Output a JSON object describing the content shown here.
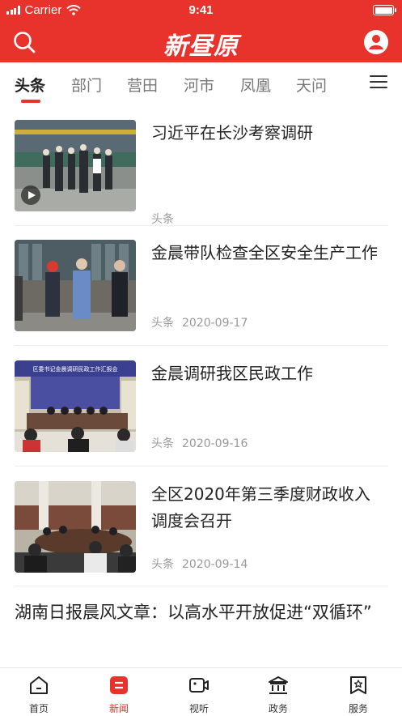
{
  "status_bar": {
    "carrier": "Carrier",
    "time": "9:41"
  },
  "header": {
    "logo_text": "新昼原"
  },
  "tabs": [
    {
      "label": "头条"
    },
    {
      "label": "部门"
    },
    {
      "label": "营田"
    },
    {
      "label": "河市"
    },
    {
      "label": "凤凰"
    },
    {
      "label": "天问"
    }
  ],
  "articles": [
    {
      "title": "习近平在长沙考察调研",
      "category": "头条",
      "date": ""
    },
    {
      "title": "金晨带队检查全区安全生产工作",
      "category": "头条",
      "date": "2020-09-17"
    },
    {
      "title": "金晨调研我区民政工作",
      "category": "头条",
      "date": "2020-09-16"
    },
    {
      "title": "全区2020年第三季度财政收入调度会召开",
      "category": "头条",
      "date": "2020-09-14"
    }
  ],
  "featured_text": "湖南日报晨风文章：以高水平开放促进“双循环”",
  "banner_text": "区委书记金晨调研民政工作汇报会",
  "tabbar": [
    {
      "label": "首页",
      "icon": "home-icon"
    },
    {
      "label": "新闻",
      "icon": "news-icon"
    },
    {
      "label": "视听",
      "icon": "video-icon"
    },
    {
      "label": "政务",
      "icon": "government-icon"
    },
    {
      "label": "服务",
      "icon": "service-icon"
    }
  ],
  "colors": {
    "brand": "#e8322c"
  }
}
